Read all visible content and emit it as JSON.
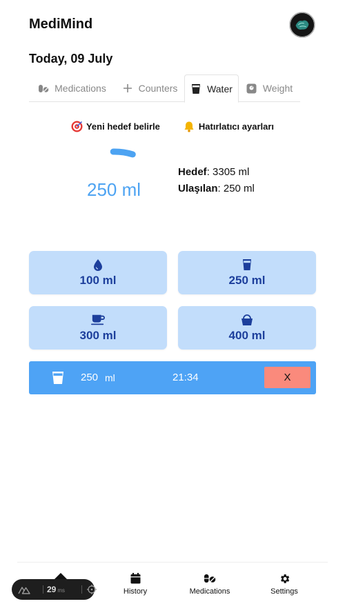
{
  "header": {
    "app_title": "MediMind"
  },
  "date_label": "Today, 09 July",
  "tabs": [
    {
      "label": "Medications",
      "icon": "pills-icon"
    },
    {
      "label": "Counters",
      "icon": "plus-icon"
    },
    {
      "label": "Water",
      "icon": "glass-icon",
      "active": true
    },
    {
      "label": "Weight",
      "icon": "scale-icon"
    }
  ],
  "links": {
    "goal": {
      "label": "Yeni hedef belirle",
      "icon": "target-icon"
    },
    "reminder": {
      "label": "Hatırlatıcı ayarları",
      "icon": "bell-icon"
    }
  },
  "progress": {
    "current": "250 ml",
    "fraction": 0.0756
  },
  "stats": {
    "goal_label": "Hedef",
    "goal_value": ": 3305 ml",
    "reached_label": "Ulaşılan",
    "reached_value": ": 250 ml"
  },
  "quick_add": [
    {
      "label": "100 ml",
      "icon": "droplet-icon"
    },
    {
      "label": "250 ml",
      "icon": "glass-icon"
    },
    {
      "label": "300 ml",
      "icon": "mug-icon"
    },
    {
      "label": "400 ml",
      "icon": "bucket-icon"
    }
  ],
  "log": {
    "amount": "250",
    "unit": "ml",
    "time": "21:34",
    "delete_label": "X"
  },
  "bottom_nav": [
    {
      "label": "History",
      "icon": "calendar-icon"
    },
    {
      "label": "Medications",
      "icon": "pills-icon"
    },
    {
      "label": "Settings",
      "icon": "gear-icon"
    }
  ],
  "perf_badge": {
    "value": "29",
    "unit": "ms"
  },
  "colors": {
    "accent": "#4da3f2",
    "quick_bg": "#c2ddfb",
    "quick_text": "#1d3f9c",
    "log_bg": "#4ea3f5",
    "delete_bg": "#fa8a7c"
  }
}
